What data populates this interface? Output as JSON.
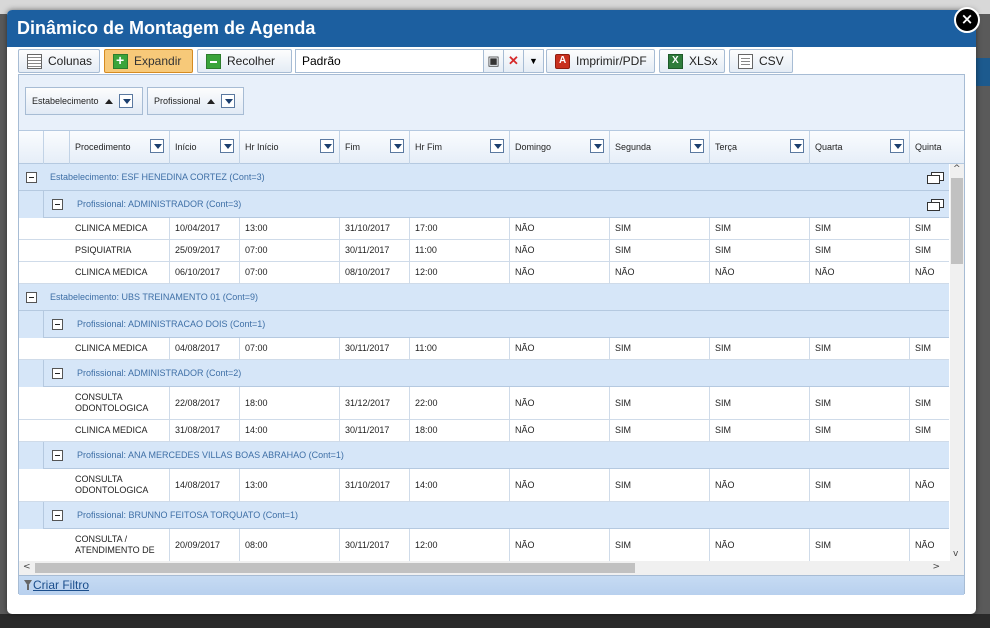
{
  "window": {
    "title": "Dinâmico de Montagem de Agenda",
    "close_label": "×"
  },
  "toolbar": {
    "colunas": "Colunas",
    "expandir": "Expandir",
    "recolher": "Recolher",
    "layout_value": "Padrão",
    "imprimir": "Imprimir/PDF",
    "xlsx": "XLSx",
    "csv": "CSV"
  },
  "groupbar": {
    "chip1": "Estabelecimento",
    "chip2": "Profissional"
  },
  "columns": [
    "Procedimento",
    "Início",
    "Hr Início",
    "Fim",
    "Hr Fim",
    "Domingo",
    "Segunda",
    "Terça",
    "Quarta",
    "Quinta"
  ],
  "groups": [
    {
      "label": "Estabelecimento: ESF HENEDINA CORTEZ (Cont=3)",
      "subgroups": [
        {
          "label": "Profissional: ADMINISTRADOR (Cont=3)",
          "rows": [
            [
              "CLINICA MEDICA",
              "10/04/2017",
              "13:00",
              "31/10/2017",
              "17:00",
              "NÃO",
              "SIM",
              "SIM",
              "SIM",
              "SIM"
            ],
            [
              "PSIQUIATRIA",
              "25/09/2017",
              "07:00",
              "30/11/2017",
              "11:00",
              "NÃO",
              "SIM",
              "SIM",
              "SIM",
              "SIM"
            ],
            [
              "CLINICA MEDICA",
              "06/10/2017",
              "07:00",
              "08/10/2017",
              "12:00",
              "NÃO",
              "NÃO",
              "NÃO",
              "NÃO",
              "NÃO"
            ]
          ]
        }
      ]
    },
    {
      "label": "Estabelecimento: UBS TREINAMENTO 01 (Cont=9)",
      "subgroups": [
        {
          "label": "Profissional: ADMINISTRACAO DOIS (Cont=1)",
          "rows": [
            [
              "CLINICA MEDICA",
              "04/08/2017",
              "07:00",
              "30/11/2017",
              "11:00",
              "NÃO",
              "SIM",
              "SIM",
              "SIM",
              "SIM"
            ]
          ]
        },
        {
          "label": "Profissional: ADMINISTRADOR (Cont=2)",
          "rows": [
            [
              "CONSULTA ODONTOLOGICA",
              "22/08/2017",
              "18:00",
              "31/12/2017",
              "22:00",
              "NÃO",
              "SIM",
              "SIM",
              "SIM",
              "SIM"
            ],
            [
              "CLINICA MEDICA",
              "31/08/2017",
              "14:00",
              "30/11/2017",
              "18:00",
              "NÃO",
              "SIM",
              "SIM",
              "SIM",
              "SIM"
            ]
          ]
        },
        {
          "label": "Profissional: ANA MERCEDES VILLAS BOAS ABRAHAO (Cont=1)",
          "rows": [
            [
              "CONSULTA ODONTOLOGICA",
              "14/08/2017",
              "13:00",
              "31/10/2017",
              "14:00",
              "NÃO",
              "SIM",
              "NÃO",
              "SIM",
              "NÃO"
            ]
          ]
        },
        {
          "label": "Profissional: BRUNNO FEITOSA TORQUATO (Cont=1)",
          "rows": [
            [
              "CONSULTA / ATENDIMENTO DE",
              "20/09/2017",
              "08:00",
              "30/11/2017",
              "12:00",
              "NÃO",
              "SIM",
              "NÃO",
              "SIM",
              "NÃO"
            ]
          ]
        }
      ]
    }
  ],
  "footer": {
    "criar_filtro": "Criar Filtro"
  }
}
